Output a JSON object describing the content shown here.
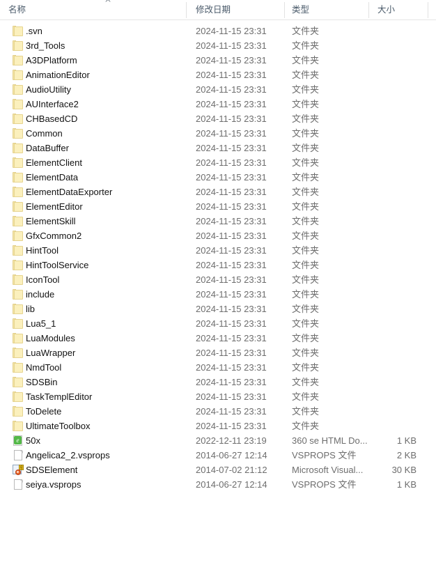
{
  "columns": {
    "name": "名称",
    "date_modified": "修改日期",
    "type": "类型",
    "size": "大小",
    "sort_caret": "^"
  },
  "rows": [
    {
      "name": ".svn",
      "date": "2024-11-15 23:31",
      "type": "文件夹",
      "size": "",
      "icon": "folder-icon"
    },
    {
      "name": "3rd_Tools",
      "date": "2024-11-15 23:31",
      "type": "文件夹",
      "size": "",
      "icon": "folder-icon"
    },
    {
      "name": "A3DPlatform",
      "date": "2024-11-15 23:31",
      "type": "文件夹",
      "size": "",
      "icon": "folder-icon"
    },
    {
      "name": "AnimationEditor",
      "date": "2024-11-15 23:31",
      "type": "文件夹",
      "size": "",
      "icon": "folder-icon"
    },
    {
      "name": "AudioUtility",
      "date": "2024-11-15 23:31",
      "type": "文件夹",
      "size": "",
      "icon": "folder-icon"
    },
    {
      "name": "AUInterface2",
      "date": "2024-11-15 23:31",
      "type": "文件夹",
      "size": "",
      "icon": "folder-icon"
    },
    {
      "name": "CHBasedCD",
      "date": "2024-11-15 23:31",
      "type": "文件夹",
      "size": "",
      "icon": "folder-icon"
    },
    {
      "name": "Common",
      "date": "2024-11-15 23:31",
      "type": "文件夹",
      "size": "",
      "icon": "folder-icon"
    },
    {
      "name": "DataBuffer",
      "date": "2024-11-15 23:31",
      "type": "文件夹",
      "size": "",
      "icon": "folder-icon"
    },
    {
      "name": "ElementClient",
      "date": "2024-11-15 23:31",
      "type": "文件夹",
      "size": "",
      "icon": "folder-icon"
    },
    {
      "name": "ElementData",
      "date": "2024-11-15 23:31",
      "type": "文件夹",
      "size": "",
      "icon": "folder-icon"
    },
    {
      "name": "ElementDataExporter",
      "date": "2024-11-15 23:31",
      "type": "文件夹",
      "size": "",
      "icon": "folder-icon"
    },
    {
      "name": "ElementEditor",
      "date": "2024-11-15 23:31",
      "type": "文件夹",
      "size": "",
      "icon": "folder-icon"
    },
    {
      "name": "ElementSkill",
      "date": "2024-11-15 23:31",
      "type": "文件夹",
      "size": "",
      "icon": "folder-icon"
    },
    {
      "name": "GfxCommon2",
      "date": "2024-11-15 23:31",
      "type": "文件夹",
      "size": "",
      "icon": "folder-icon"
    },
    {
      "name": "HintTool",
      "date": "2024-11-15 23:31",
      "type": "文件夹",
      "size": "",
      "icon": "folder-icon"
    },
    {
      "name": "HintToolService",
      "date": "2024-11-15 23:31",
      "type": "文件夹",
      "size": "",
      "icon": "folder-icon"
    },
    {
      "name": "IconTool",
      "date": "2024-11-15 23:31",
      "type": "文件夹",
      "size": "",
      "icon": "folder-icon"
    },
    {
      "name": "include",
      "date": "2024-11-15 23:31",
      "type": "文件夹",
      "size": "",
      "icon": "folder-icon"
    },
    {
      "name": "lib",
      "date": "2024-11-15 23:31",
      "type": "文件夹",
      "size": "",
      "icon": "folder-icon"
    },
    {
      "name": "Lua5_1",
      "date": "2024-11-15 23:31",
      "type": "文件夹",
      "size": "",
      "icon": "folder-icon"
    },
    {
      "name": "LuaModules",
      "date": "2024-11-15 23:31",
      "type": "文件夹",
      "size": "",
      "icon": "folder-icon"
    },
    {
      "name": "LuaWrapper",
      "date": "2024-11-15 23:31",
      "type": "文件夹",
      "size": "",
      "icon": "folder-icon"
    },
    {
      "name": "NmdTool",
      "date": "2024-11-15 23:31",
      "type": "文件夹",
      "size": "",
      "icon": "folder-icon"
    },
    {
      "name": "SDSBin",
      "date": "2024-11-15 23:31",
      "type": "文件夹",
      "size": "",
      "icon": "folder-icon"
    },
    {
      "name": "TaskTemplEditor",
      "date": "2024-11-15 23:31",
      "type": "文件夹",
      "size": "",
      "icon": "folder-icon"
    },
    {
      "name": "ToDelete",
      "date": "2024-11-15 23:31",
      "type": "文件夹",
      "size": "",
      "icon": "folder-icon"
    },
    {
      "name": "UltimateToolbox",
      "date": "2024-11-15 23:31",
      "type": "文件夹",
      "size": "",
      "icon": "folder-icon"
    },
    {
      "name": "50x",
      "date": "2022-12-11 23:19",
      "type": "360 se HTML Do...",
      "size": "1 KB",
      "icon": "html-document-icon"
    },
    {
      "name": "Angelica2_2.vsprops",
      "date": "2014-06-27 12:14",
      "type": "VSPROPS 文件",
      "size": "2 KB",
      "icon": "generic-document-icon"
    },
    {
      "name": "SDSElement",
      "date": "2014-07-02 21:12",
      "type": "Microsoft Visual...",
      "size": "30 KB",
      "icon": "visual-studio-icon"
    },
    {
      "name": "seiya.vsprops",
      "date": "2014-06-27 12:14",
      "type": "VSPROPS 文件",
      "size": "1 KB",
      "icon": "generic-document-icon"
    }
  ],
  "icon_glyphs": {
    "html_letter": "e",
    "vs_badge": "g"
  }
}
